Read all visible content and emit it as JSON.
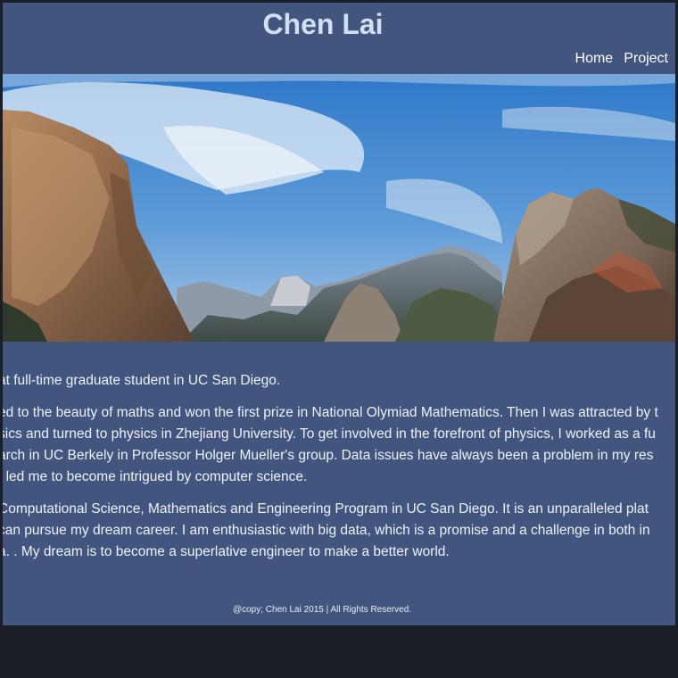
{
  "header": {
    "title": "Chen Lai",
    "nav": [
      {
        "label": "Home"
      },
      {
        "label": "Project"
      }
    ]
  },
  "content": {
    "paragraph_1": "at full-time graduate student in UC San Diego.",
    "paragraph_2_lines": [
      "ed to the beauty of maths and won the first prize in National Olymiad Mathematics. Then I was attracted by t",
      "sics and turned to physics in Zhejiang University. To get involved in the forefront of physics, I worked as a fu",
      "arch in UC Berkely in Professor Holger Mueller's group. Data issues have always been a problem in my res",
      "t led me to become intrigued by computer science."
    ],
    "paragraph_3_lines": [
      " Computational Science, Mathematics and Engineering Program in UC San Diego. It is an unparalleled plat",
      "can pursue my dream career. I am enthusiastic with big data, which is a promise and a challenge in both in",
      "a. . My dream is to become a superlative engineer to make a better world."
    ]
  },
  "footer": {
    "copyright": "@copy; Chen Lai 2015 | All Rights Reserved."
  },
  "colors": {
    "page_background": "#41557f",
    "outer_background": "#1b1e27",
    "title_color": "#cfe0f3"
  }
}
